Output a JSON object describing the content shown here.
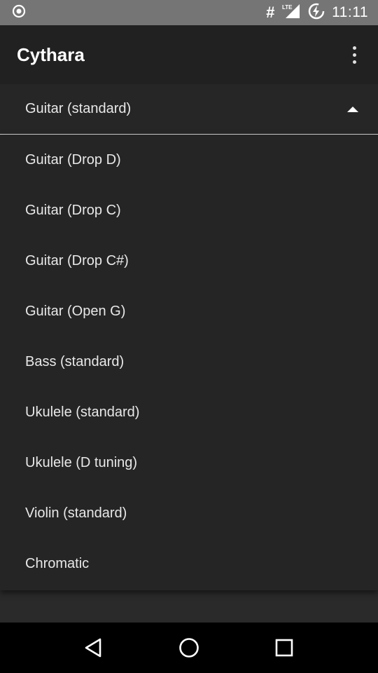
{
  "status_bar": {
    "time": "11:11",
    "icons": [
      "record-circle-icon",
      "hash-icon",
      "lte-signal-icon",
      "battery-charging-icon"
    ],
    "hash_glyph": "#",
    "lte_label": "LTE"
  },
  "app_bar": {
    "title": "Cythara",
    "menu_icon": "overflow-menu-icon"
  },
  "tuning_dropdown": {
    "selected": "Guitar (standard)",
    "options": [
      "Guitar (Drop D)",
      "Guitar (Drop C)",
      "Guitar (Drop C#)",
      "Guitar (Open G)",
      "Bass (standard)",
      "Ukulele (standard)",
      "Ukulele (D tuning)",
      "Violin (standard)",
      "Chromatic"
    ]
  },
  "nav_bar": {
    "buttons": [
      "back-icon",
      "home-icon",
      "recents-icon"
    ]
  },
  "colors": {
    "status_bar": "#757575",
    "app_bar": "#212121",
    "background": "#2a2a2a",
    "text": "#e8e8e8",
    "nav_bar": "#000000"
  }
}
